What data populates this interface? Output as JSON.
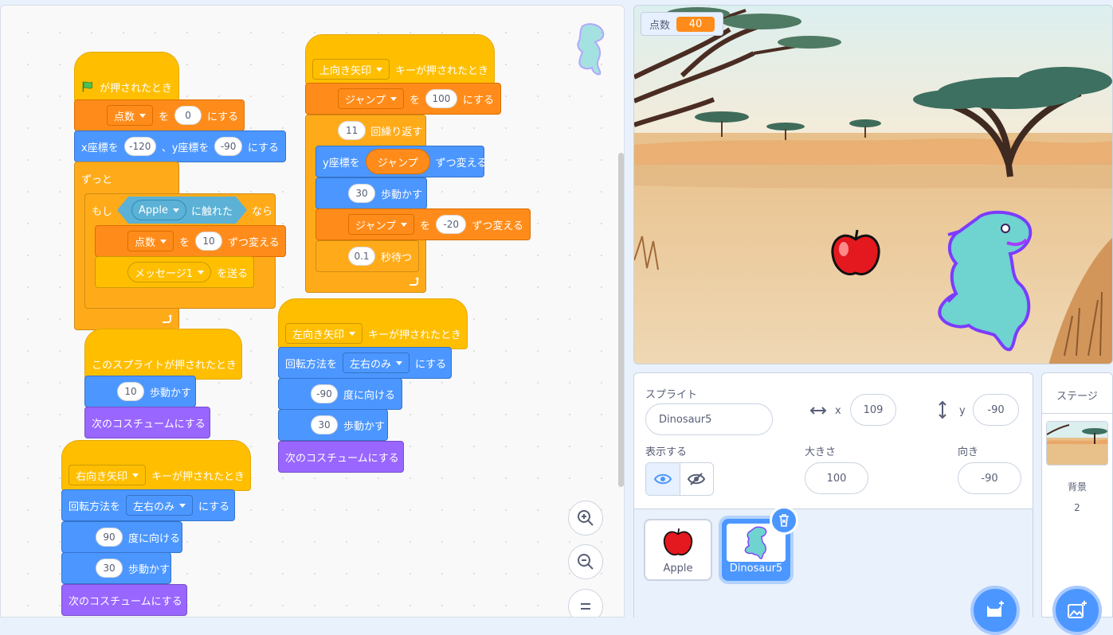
{
  "scripts": {
    "flag": {
      "hat": "が押されたとき",
      "set_var": "点数",
      "set_wo": "を",
      "set_val": "0",
      "set_suru": "にする",
      "goto_x_label": "x座標を",
      "goto_x": "-120",
      "goto_y_label": "、y座標を",
      "goto_y": "-90",
      "goto_suru": "にする",
      "forever": "ずっと",
      "if_label": "もし",
      "touch_obj": "Apple",
      "touch_label": "に触れた",
      "then": "なら",
      "change_var": "点数",
      "change_wo": "を",
      "change_val": "10",
      "change_label": "ずつ変える",
      "bcast_msg": "メッセージ1",
      "bcast_label": "を送る"
    },
    "click": {
      "hat": "このスプライトが押されたとき",
      "move_val": "10",
      "move_label": "歩動かす",
      "next_costume": "次のコスチュームにする"
    },
    "right": {
      "key": "右向き矢印",
      "hat": "キーが押されたとき",
      "rot_label": "回転方法を",
      "rot_val": "左右のみ",
      "rot_suru": "にする",
      "dir_val": "90",
      "dir_label": "度に向ける",
      "move_val": "30",
      "move_label": "歩動かす",
      "next_costume": "次のコスチュームにする"
    },
    "up": {
      "key": "上向き矢印",
      "hat": "キーが押されたとき",
      "set_var": "ジャンプ",
      "set_wo": "を",
      "set_val": "100",
      "set_suru": "にする",
      "repeat_val": "11",
      "repeat_label": "回繰り返す",
      "changey_label": "y座標を",
      "changey_var": "ジャンプ",
      "changey_suffix": "ずつ変える",
      "move_val": "30",
      "move_label": "歩動かす",
      "change_var": "ジャンプ",
      "change_wo": "を",
      "change_val": "-20",
      "change_label": "ずつ変える",
      "wait_val": "0.1",
      "wait_label": "秒待つ"
    },
    "left": {
      "key": "左向き矢印",
      "hat": "キーが押されたとき",
      "rot_label": "回転方法を",
      "rot_val": "左右のみ",
      "rot_suru": "にする",
      "dir_val": "-90",
      "dir_label": "度に向ける",
      "move_val": "30",
      "move_label": "歩動かす",
      "next_costume": "次のコスチュームにする"
    }
  },
  "stage": {
    "monitor_label": "点数",
    "monitor_value": "40"
  },
  "sprite_info": {
    "title": "スプライト",
    "name": "Dinosaur5",
    "x_label": "x",
    "x": "109",
    "y_label": "y",
    "y": "-90",
    "show_label": "表示する",
    "size_label": "大きさ",
    "size": "100",
    "direction_label": "向き",
    "direction": "-90"
  },
  "sprites": [
    {
      "name": "Apple"
    },
    {
      "name": "Dinosaur5"
    }
  ],
  "stage_pane": {
    "title": "ステージ",
    "backdrop_label": "背景",
    "backdrop_count": "2"
  },
  "colors": {
    "events": "#ffbf00",
    "control": "#ffab19",
    "variables": "#ff8c1a",
    "motion": "#4c97ff",
    "looks": "#9966ff",
    "sensing": "#5cb1d6"
  }
}
